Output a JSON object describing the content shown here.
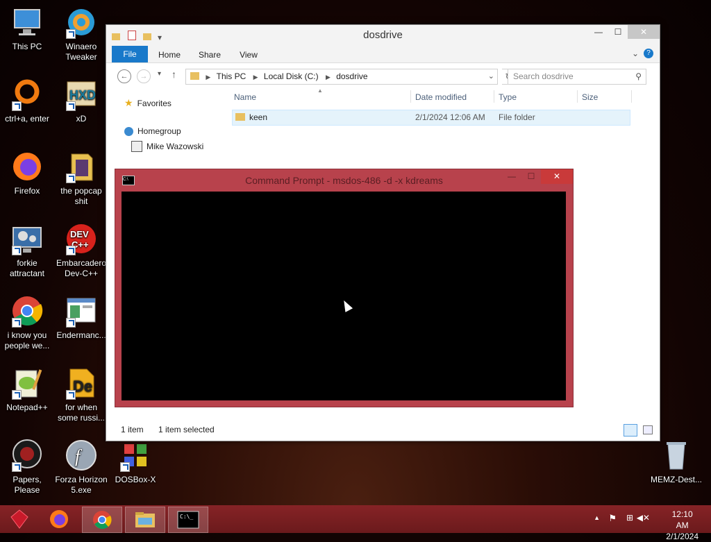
{
  "desktop_icons": [
    {
      "label": "This PC",
      "icon": "computer-icon"
    },
    {
      "label": "Winaero Tweaker",
      "icon": "winaero-icon"
    },
    {
      "label": "ctrl+a, enter",
      "icon": "ring-icon"
    },
    {
      "label": "xD",
      "icon": "hxd-icon"
    },
    {
      "label": "Firefox",
      "icon": "firefox-icon"
    },
    {
      "label": "the popcap shit",
      "icon": "popcap-icon"
    },
    {
      "label": "forkie attractant",
      "icon": "gear-monitor-icon"
    },
    {
      "label": "Embarcadero Dev-C++",
      "icon": "devcpp-icon"
    },
    {
      "label": "i know you people we...",
      "icon": "chrome-icon"
    },
    {
      "label": "Endermanc...",
      "icon": "window-icon"
    },
    {
      "label": "Notepad++",
      "icon": "notepadpp-icon"
    },
    {
      "label": "for when some russi...",
      "icon": "de-icon"
    },
    {
      "label": "Papers, Please",
      "icon": "papers-please-icon"
    },
    {
      "label": "Forza Horizon 5.exe",
      "icon": "flash-icon"
    },
    {
      "label": "DOSBox-X",
      "icon": "dosbox-icon"
    },
    {
      "label": "MEMZ-Dest...",
      "icon": "recycle-bin-icon"
    }
  ],
  "explorer": {
    "title": "dosdrive",
    "ribbon_tabs": [
      "File",
      "Home",
      "Share",
      "View"
    ],
    "address": {
      "crumbs": [
        "This PC",
        "Local Disk (C:)",
        "dosdrive"
      ]
    },
    "search_placeholder": "Search dosdrive",
    "nav": {
      "favorites": "Favorites",
      "homegroup": "Homegroup",
      "user": "Mike Wazowski"
    },
    "columns": [
      "Name",
      "Date modified",
      "Type",
      "Size"
    ],
    "files": [
      {
        "name": "keen",
        "date": "2/1/2024 12:06 AM",
        "type": "File folder",
        "size": ""
      }
    ],
    "status": {
      "count": "1 item",
      "selected": "1 item selected"
    }
  },
  "cmd": {
    "title": "Command Prompt - msdos-486 -d -x kdreams"
  },
  "taskbar": {
    "items": [
      "ruby-icon",
      "firefox-icon",
      "chrome-icon",
      "file-explorer-icon",
      "cmd-icon"
    ],
    "clock_time": "12:10 AM",
    "clock_date": "2/1/2024"
  },
  "colors": {
    "accent": "#1979ca",
    "cmd_frame": "#b8424c",
    "taskbar": "#7a1e20"
  }
}
